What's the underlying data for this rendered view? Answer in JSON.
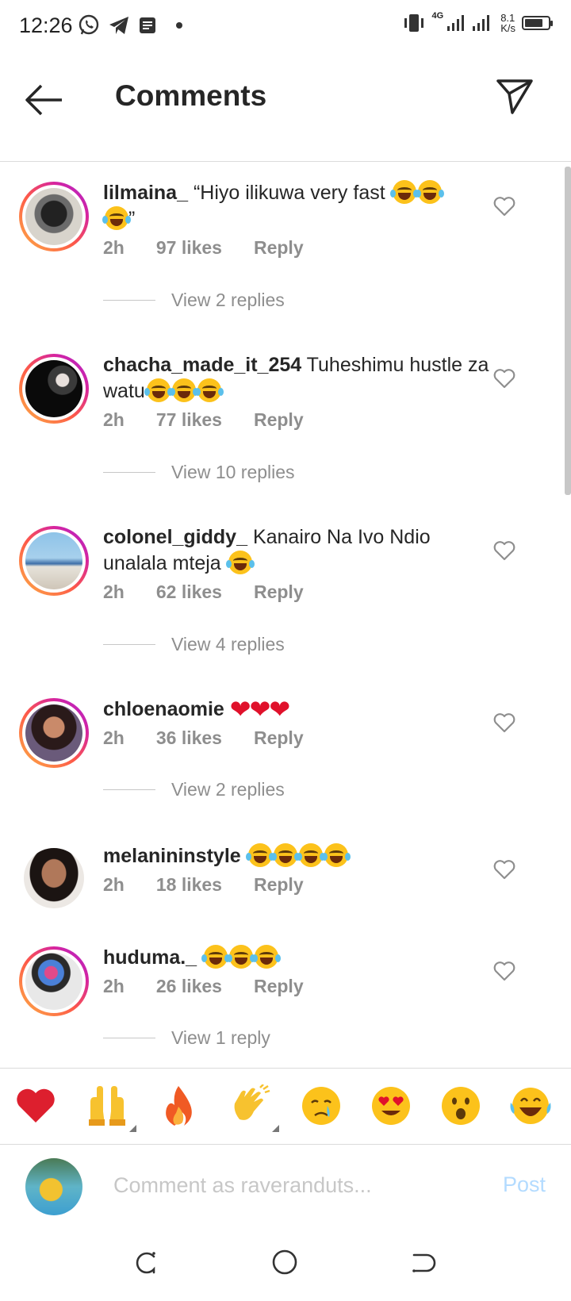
{
  "status_bar": {
    "time": "12:26",
    "network": "4G",
    "speed_value": "8.1",
    "speed_unit": "K/s"
  },
  "header": {
    "title": "Comments"
  },
  "comments": [
    {
      "username": "lilmaina_",
      "text": "“Hiyo ilikuwa very fast",
      "text_suffix": "”",
      "emoji_count": 3,
      "time": "2h",
      "likes": "97 likes",
      "reply_label": "Reply",
      "view_replies": "View 2 replies",
      "story_ring": true
    },
    {
      "username": "chacha_made_it_254",
      "text": "Tuheshimu hustle za watu",
      "emoji_count": 3,
      "time": "2h",
      "likes": "77 likes",
      "reply_label": "Reply",
      "view_replies": "View 10 replies",
      "story_ring": true
    },
    {
      "username": "colonel_giddy_",
      "text": "Kanairo Na Ivo Ndio unalala mteja",
      "emoji_count": 1,
      "time": "2h",
      "likes": "62 likes",
      "reply_label": "Reply",
      "view_replies": "View 4 replies",
      "story_ring": true
    },
    {
      "username": "chloenaomie",
      "text": "",
      "hearts": "❤❤❤",
      "time": "2h",
      "likes": "36 likes",
      "reply_label": "Reply",
      "view_replies": "View 2 replies",
      "story_ring": true
    },
    {
      "username": "melanininstyle",
      "text": "",
      "emoji_count": 4,
      "time": "2h",
      "likes": "18 likes",
      "reply_label": "Reply",
      "story_ring": false
    },
    {
      "username": "huduma._",
      "text": "",
      "emoji_count": 3,
      "time": "2h",
      "likes": "26 likes",
      "reply_label": "Reply",
      "view_replies": "View 1 reply",
      "story_ring": true
    }
  ],
  "emoji_bar": [
    {
      "name": "red-heart",
      "glyph": "❤"
    },
    {
      "name": "raising-hands",
      "glyph": "🙌"
    },
    {
      "name": "fire",
      "glyph": "🔥"
    },
    {
      "name": "clapping-hands",
      "glyph": "👏"
    },
    {
      "name": "crying-face",
      "glyph": "😢"
    },
    {
      "name": "heart-eyes",
      "glyph": "😍"
    },
    {
      "name": "astonished-face",
      "glyph": "😮"
    },
    {
      "name": "tears-of-joy",
      "glyph": "😂"
    }
  ],
  "comment_input": {
    "placeholder": "Comment as raveranduts...",
    "post_label": "Post"
  },
  "colors": {
    "text": "#262626",
    "muted": "#8e8e8e",
    "post_disabled": "#b3dbff",
    "divider": "#dbdbdb"
  }
}
